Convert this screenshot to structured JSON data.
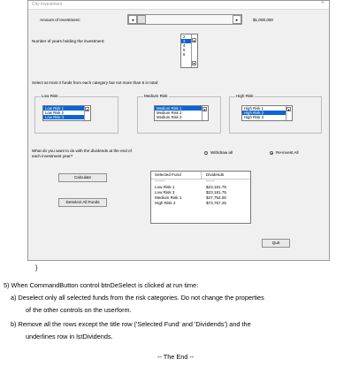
{
  "window": {
    "title": "City Investment",
    "close": "×"
  },
  "amount": {
    "label": "Amount of Investment:",
    "value": "$1,000,000",
    "left_arrow": "◂",
    "right_arrow": "▸",
    "position": 0.0
  },
  "years": {
    "label": "Number of years holding the investment:",
    "items": [
      "2",
      "3",
      "4",
      "5",
      "6"
    ],
    "selected": "3"
  },
  "instruction": "Select at most 3 funds from each category but not more than 6 in total:",
  "frames": {
    "low": {
      "title": "Low Risk",
      "items": [
        "Low Risk 1",
        "Low Risk 2",
        "Low Risk 3"
      ],
      "selected": [
        "Low Risk 1",
        "Low Risk 3"
      ]
    },
    "medium": {
      "title": "Medium Risk",
      "items": [
        "Medium Risk 1",
        "Medium Risk 2",
        "Medium Risk 3"
      ],
      "selected": [
        "Medium Risk 1"
      ]
    },
    "high": {
      "title": "High Risk",
      "items": [
        "High Risk 1",
        "High Risk 2",
        "High Risk 3"
      ],
      "selected": [
        "High Risk 2"
      ]
    }
  },
  "dividends_question": {
    "line1": "What do you want to do with the dividends at the end of",
    "line2": "each investment year?"
  },
  "options": {
    "withdraw": "Withdraw all",
    "reinvest": "Re-invest All",
    "selected": "reinvest"
  },
  "buttons": {
    "calculate": "Calculate",
    "deselect": "Deselect All Funds",
    "quit": "Quit"
  },
  "results": {
    "headers": [
      "Selected Fund",
      "Dividends"
    ],
    "underline": [
      "------------",
      "----------"
    ],
    "rows": [
      [
        "Low Risk 1",
        "$23,181.75"
      ],
      [
        "Low Risk 3",
        "$23,181.75"
      ],
      [
        "Medium Risk 1",
        "$47,754.00"
      ],
      [
        "High Risk 2",
        "$73,757.25"
      ]
    ]
  },
  "doc": {
    "brace": "}",
    "q5": "5)  When CommandButton control btnDeSelect is clicked at run time:",
    "a1": "a)  Deselect only all selected funds from the risk categories. Do not change the properties",
    "a2": "of the other controls on the userform.",
    "b1": "b)  Remove all the rows except the title row ('Selected Fund' and 'Dividends') and the",
    "b2": "underlines row in lstDividends.",
    "end": "-- The End --"
  },
  "colors": {
    "selection": "#0a64d8",
    "form_bg": "#f0f0f0"
  }
}
